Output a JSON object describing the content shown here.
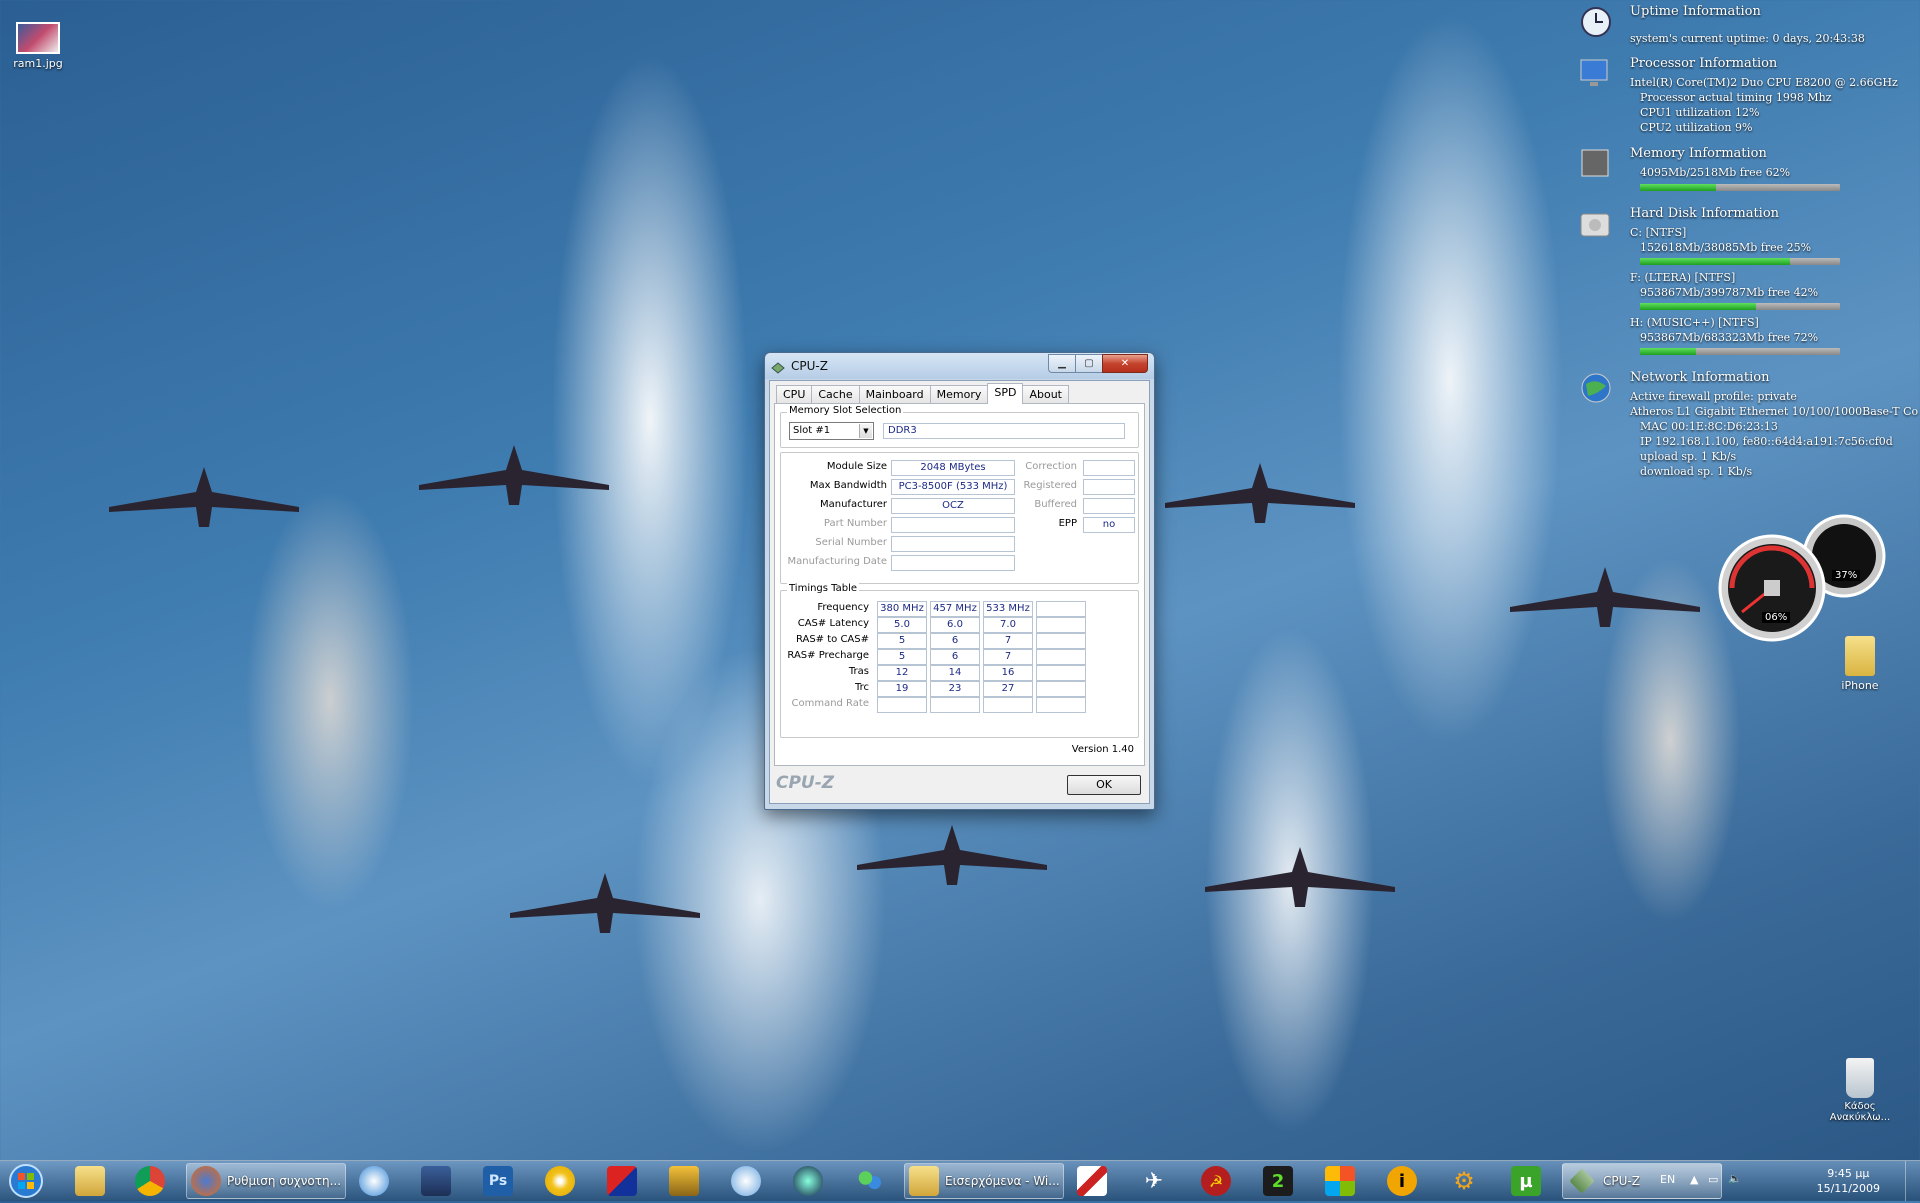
{
  "desktop": {
    "icons": [
      {
        "label": "ram1.jpg"
      },
      {
        "label": "iPhone"
      },
      {
        "label": "Κάδος Ανακύκλω..."
      }
    ]
  },
  "gadget": {
    "uptime": {
      "title": "Uptime Information",
      "line": "system's current uptime: 0 days, 20:43:38"
    },
    "processor": {
      "title": "Processor Information",
      "lines": [
        "Intel(R) Core(TM)2 Duo CPU     E8200  @ 2.66GHz",
        "Processor actual timing 1998 Mhz",
        "CPU1 utilization       12%",
        "CPU2 utilization       9%"
      ]
    },
    "memory": {
      "title": "Memory Information",
      "line": "4095Mb/2518Mb  free 62%",
      "usage": 0.38
    },
    "disk": {
      "title": "Hard Disk Information",
      "drives": [
        {
          "name": "C: [NTFS]",
          "line": "152618Mb/38085Mb  free 25%",
          "usage": 0.75
        },
        {
          "name": "F: (LTERA)  [NTFS]",
          "line": "953867Mb/399787Mb  free 42%",
          "usage": 0.58
        },
        {
          "name": "H: (MUSIC++)  [NTFS]",
          "line": "953867Mb/683323Mb  free 72%",
          "usage": 0.28
        }
      ]
    },
    "network": {
      "title": "Network Information",
      "lines": [
        "Active firewall profile: private",
        "Atheros L1 Gigabit Ethernet 10/100/1000Base-T Co",
        "MAC  00:1E:8C:D6:23:13",
        "IP  192.168.1.100, fe80::64d4:a191:7c56:cf0d",
        "upload sp.       1 Kb/s",
        "download sp.   1 Kb/s"
      ]
    },
    "meter": {
      "cpu": "06%",
      "mem": "37%"
    }
  },
  "window": {
    "title": "CPU-Z",
    "tabs": [
      "CPU",
      "Cache",
      "Mainboard",
      "Memory",
      "SPD",
      "About"
    ],
    "active_tab": "SPD",
    "slot_group": "Memory Slot Selection",
    "slot": "Slot #1",
    "type": "DDR3",
    "module": {
      "labels": [
        "Module Size",
        "Max Bandwidth",
        "Manufacturer",
        "Part Number",
        "Serial Number",
        "Manufacturing Date"
      ],
      "values": [
        "2048 MBytes",
        "PC3-8500F (533 MHz)",
        "OCZ",
        "",
        "",
        ""
      ],
      "right_labels": [
        "Correction",
        "Registered",
        "Buffered",
        "EPP"
      ],
      "right_values": [
        "",
        "",
        "",
        "no"
      ]
    },
    "timings": {
      "group": "Timings Table",
      "rows": [
        {
          "label": "Frequency",
          "values": [
            "380 MHz",
            "457 MHz",
            "533 MHz",
            ""
          ]
        },
        {
          "label": "CAS# Latency",
          "values": [
            "5.0",
            "6.0",
            "7.0",
            ""
          ]
        },
        {
          "label": "RAS# to CAS#",
          "values": [
            "5",
            "6",
            "7",
            ""
          ]
        },
        {
          "label": "RAS# Precharge",
          "values": [
            "5",
            "6",
            "7",
            ""
          ]
        },
        {
          "label": "Tras",
          "values": [
            "12",
            "14",
            "16",
            ""
          ]
        },
        {
          "label": "Trc",
          "values": [
            "19",
            "23",
            "27",
            ""
          ]
        },
        {
          "label": "Command Rate",
          "values": [
            "",
            "",
            "",
            ""
          ]
        }
      ]
    },
    "version": "Version 1.40",
    "logo": "CPU-Z",
    "ok": "OK"
  },
  "taskbar": {
    "buttons": [
      {
        "label": "Ρυθμιση συχνοτη..."
      },
      {
        "label": "Εισερχόμενα - Wi..."
      },
      {
        "label": "CPU-Z"
      }
    ],
    "lang": "EN",
    "time": "9:45 μμ",
    "date": "15/11/2009"
  },
  "colors": {
    "accent": "#1d2b86",
    "bar": "#22a622",
    "close": "#c5452f"
  }
}
